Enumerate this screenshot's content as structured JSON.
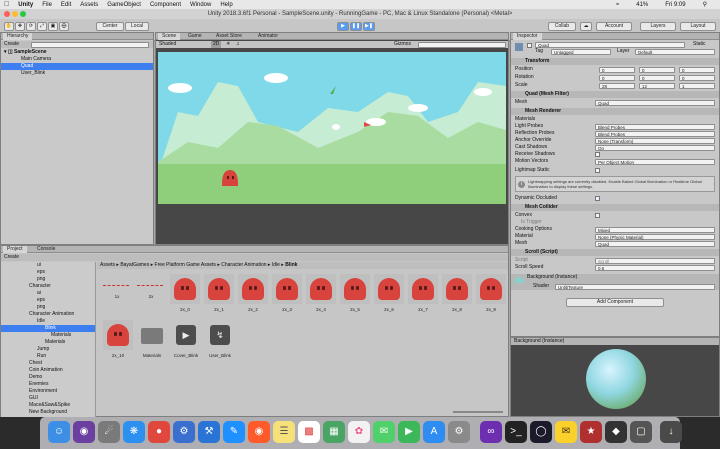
{
  "menubar": {
    "apple": "",
    "app": "Unity",
    "items": [
      "File",
      "Edit",
      "Assets",
      "GameObject",
      "Component",
      "Window",
      "Help"
    ],
    "status": [
      "41%",
      "Fri 9:09"
    ]
  },
  "window": {
    "title": "Unity 2018.3.6f1 Personal - SampleScene.unity - RunningGame - PC, Mac & Linux Standalone (Personal) <Metal>"
  },
  "toolbar": {
    "center": "Center",
    "local": "Local",
    "collab": "Collab",
    "account": "Account",
    "layers": "Layers",
    "layout": "Layout"
  },
  "hierarchy": {
    "tab": "Hierarchy",
    "create": "Create",
    "search_placeholder": "All",
    "scene": "SampleScene",
    "items": [
      "Main Camera",
      "Quad",
      "User_Blink"
    ]
  },
  "scene": {
    "tabs": [
      "Scene",
      "Game",
      "Asset Store",
      "Animator"
    ],
    "shading": "Shaded",
    "mode": "2D",
    "gizmos": "Gizmos",
    "search_placeholder": "All"
  },
  "project": {
    "tabs": [
      "Project",
      "Console"
    ],
    "create": "Create",
    "breadcrumb": [
      "Assets",
      "BayatGames",
      "Free Platform Game Assets",
      "Character Animation",
      "Idle",
      "Blink"
    ],
    "tree": [
      "ui",
      "eps",
      "png",
      "Character",
      "ai",
      "eps",
      "png",
      "Character Animation",
      "Idle",
      "Blink",
      "Materials",
      "Materials",
      "Jump",
      "Run",
      "Chest",
      "Coin Animation",
      "Demo",
      "Enemies",
      "Environment",
      "GUI",
      "Mace&Saw&Spike",
      "New Background"
    ],
    "timeline_labels": [
      "1x",
      "2x"
    ],
    "frames": [
      "2x_0",
      "2x_1",
      "2x_2",
      "2x_3",
      "2x_4",
      "2x_5",
      "2x_6",
      "2x_7",
      "2x_8",
      "2x_9"
    ],
    "row2": [
      "2x_10",
      "Materials",
      "Cover_Blink",
      "User_Blink"
    ]
  },
  "inspector": {
    "tab": "Inspector",
    "name": "Quad",
    "static": "Static",
    "tag_label": "Tag",
    "tag": "Untagged",
    "layer_label": "Layer",
    "layer": "Default",
    "transform": {
      "title": "Transform",
      "position": [
        "0",
        "0",
        "0"
      ],
      "rotation": [
        "0",
        "0",
        "0"
      ],
      "scale": [
        "28",
        "12",
        "1"
      ],
      "labels": [
        "Position",
        "Rotation",
        "Scale"
      ]
    },
    "mesh_filter": {
      "title": "Quad (Mesh Filter)",
      "mesh_label": "Mesh",
      "mesh": "Quad"
    },
    "mesh_renderer": {
      "title": "Mesh Renderer",
      "rows": [
        [
          "Materials",
          ""
        ],
        [
          "Light Probes",
          "Blend Probes"
        ],
        [
          "Reflection Probes",
          "Blend Probes"
        ],
        [
          "Anchor Override",
          "None (Transform)"
        ],
        [
          "Cast Shadows",
          "On"
        ],
        [
          "Receive Shadows",
          ""
        ],
        [
          "Motion Vectors",
          "Per Object Motion"
        ],
        [
          "Lightmap Static",
          ""
        ]
      ],
      "info": "Lightmapping settings are currently disabled. Enable Baked Global Illumination or Realtime Global Illumination to display these settings.",
      "dynamic": "Dynamic Occluded"
    },
    "mesh_collider": {
      "title": "Mesh Collider",
      "rows": [
        [
          "Convex",
          ""
        ],
        [
          "Is Trigger",
          ""
        ],
        [
          "Cooking Options",
          "Mixed"
        ],
        [
          "Material",
          "None (Physic Material)"
        ],
        [
          "Mesh",
          "Quad"
        ]
      ]
    },
    "scroll": {
      "title": "Scroll (Script)",
      "script_label": "Script",
      "script": "Scroll",
      "speed_label": "Scroll Speed",
      "speed": "0.5"
    },
    "material": {
      "name": "Background (Instance)",
      "shader_label": "Shader",
      "shader": "Unlit/Texture"
    },
    "add_component": "Add Component",
    "preview": "Background (Instance)"
  },
  "colors": {
    "accent": "#3d7ff0",
    "sky": "#7fd9e8",
    "hill": "#8fce7a",
    "character": "#d9433d"
  }
}
